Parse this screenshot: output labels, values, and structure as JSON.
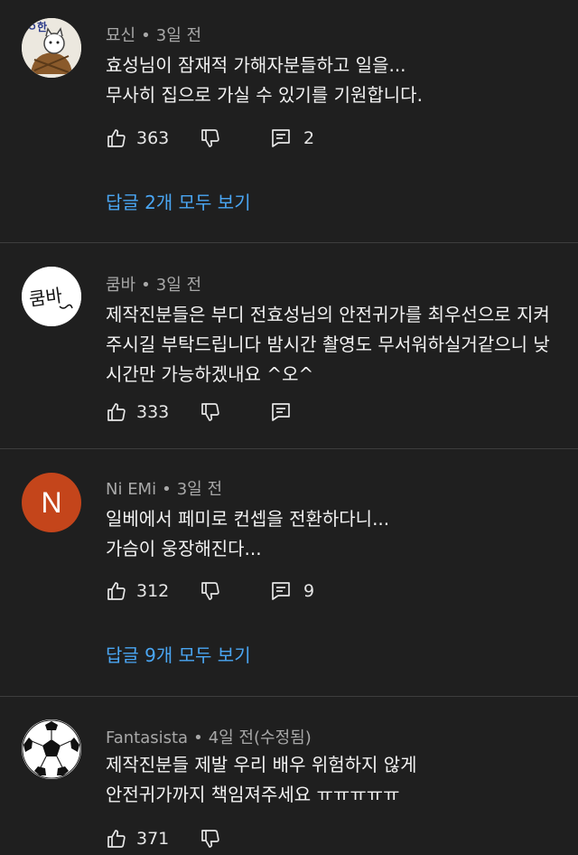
{
  "comments": [
    {
      "author": "묘신",
      "time": "3일 전",
      "lines": [
        "효성님이 잠재적 가해자분들하고 일을...",
        "무사히 집으로 가실 수 있기를 기원합니다."
      ],
      "likes": "363",
      "reply_count": "2",
      "replies_link": "답글 2개 모두 보기",
      "avatar": {
        "type": "image",
        "icon": "cat-drawing-icon",
        "bg": "#e8e4dc"
      }
    },
    {
      "author": "쿰바",
      "time": "3일 전",
      "lines": [
        "제작진분들은 부디 전효성님의 안전귀가를 최우선으로 지켜",
        "주시길 부탁드립니다 밤시간 촬영도 무서워하실거같으니 낮",
        "시간만 가능하겠내요 ^오^"
      ],
      "likes": "333",
      "reply_count": "",
      "replies_link": "",
      "avatar": {
        "type": "image",
        "icon": "handwriting-icon",
        "bg": "#ffffff",
        "text": "쿰바"
      }
    },
    {
      "author": "Ni EMi",
      "time": "3일 전",
      "lines": [
        "일베에서 페미로 컨셉을 전환하다니...",
        "가슴이 웅장해진다..."
      ],
      "likes": "312",
      "reply_count": "9",
      "replies_link": "답글 9개 모두 보기",
      "avatar": {
        "type": "letter",
        "letter": "N",
        "bg": "#c4451b"
      }
    },
    {
      "author": "Fantasista",
      "time": "4일 전(수정됨)",
      "lines": [
        "제작진분들 제발 우리 배우 위험하지 않게",
        "안전귀가까지 책임져주세요 ㅠㅠㅠㅠㅠ"
      ],
      "likes": "371",
      "reply_count": "",
      "replies_link": "",
      "avatar": {
        "type": "image",
        "icon": "soccer-ball-icon",
        "bg": "#ffffff"
      }
    }
  ],
  "meta_separator": "•",
  "colors": {
    "background": "#1f1f1f",
    "link": "#4aa6f3",
    "meta": "#a8a8a8"
  }
}
